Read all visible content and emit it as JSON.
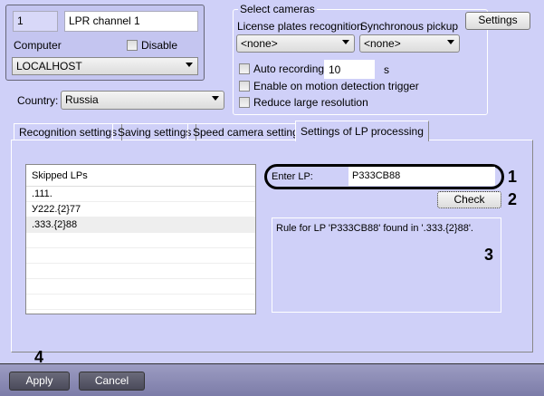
{
  "channel": {
    "id": "1",
    "name": "LPR channel 1",
    "computer_label": "Computer",
    "disable_label": "Disable",
    "disable_checked": false,
    "computer_value": "LOCALHOST"
  },
  "country": {
    "label": "Country:",
    "value": "Russia"
  },
  "cameras": {
    "group_title": "Select cameras",
    "lpr_label": "License plates recognition",
    "lpr_value": "<none>",
    "sync_label": "Synchronous pickup",
    "sync_value": "<none>",
    "auto_recording_label": "Auto recording",
    "auto_recording_value": "10",
    "auto_recording_unit": "s",
    "motion_label": "Enable on motion detection trigger",
    "reduce_label": "Reduce large resolution"
  },
  "settings_button": "Settings",
  "tabs": [
    {
      "label": "Recognition settings"
    },
    {
      "label": "Saving settings"
    },
    {
      "label": "Speed camera settings"
    },
    {
      "label": "Settings of LP processing",
      "active": true
    }
  ],
  "skipped": {
    "header": "Skipped LPs",
    "items": [
      ".111.",
      "У222.{2}77",
      ".333.{2}88"
    ],
    "selected_index": 2
  },
  "enter_lp": {
    "label": "Enter LP:",
    "value": "P333CB88"
  },
  "check_button": "Check",
  "result_text": "Rule for LP 'P333CB88' found in '.333.{2}88'.",
  "callouts": [
    "1",
    "2",
    "3",
    "4"
  ],
  "footer": {
    "apply": "Apply",
    "cancel": "Cancel"
  }
}
